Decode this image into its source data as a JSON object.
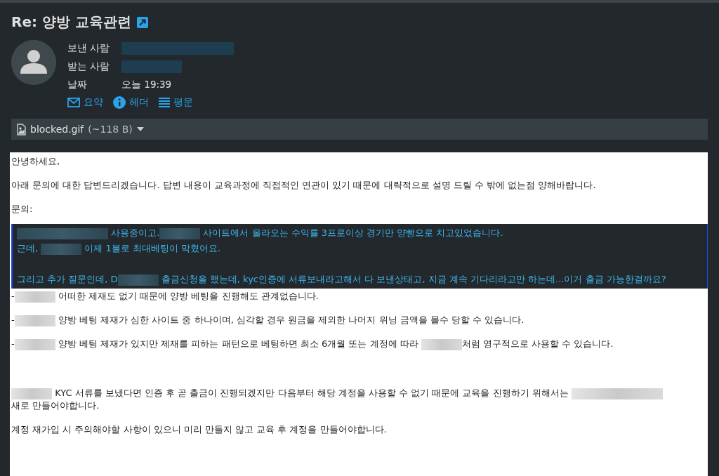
{
  "message": {
    "subject": "Re: 양방 교육관련",
    "headers": [
      {
        "label": "보낸 사람",
        "parts": [
          {
            "kind": "redacted-long"
          }
        ]
      },
      {
        "label": "받는 사람",
        "parts": [
          {
            "kind": "redacted"
          }
        ]
      },
      {
        "label": "날짜",
        "parts": [
          {
            "kind": "text",
            "text": "오늘 19:39"
          }
        ]
      }
    ],
    "view_links": [
      {
        "kind": "summary",
        "label": "요약"
      },
      {
        "kind": "headers",
        "label": "헤더"
      },
      {
        "kind": "plain",
        "label": "평문"
      }
    ]
  },
  "attachment": {
    "name": "blocked.gif",
    "size": "(~118 B)"
  },
  "body": [
    {
      "kind": "para",
      "parts": [
        {
          "kind": "text",
          "text": "안녕하세요,"
        }
      ]
    },
    {
      "kind": "para",
      "parts": [
        {
          "kind": "text",
          "text": "아래 문의에 대한 답변드리겠습니다. 답변 내용이 교육과정에 직접적인 연관이 있기 때문에 대략적으로 설명 드릴 수 밖에 없는점 양해바랍니다."
        }
      ]
    },
    {
      "kind": "para",
      "parts": [
        {
          "kind": "text",
          "text": "문의:"
        }
      ]
    },
    {
      "kind": "quote",
      "lines": [
        {
          "kind": "text",
          "parts": [
            {
              "kind": "redacted-long"
            },
            {
              "kind": "text",
              "text": " 사용중이고."
            },
            {
              "kind": "redacted"
            },
            {
              "kind": "text",
              "text": " 사이트에서 올라오는 수익률 3프로이상 경기만 양빵으로 치고있었습니다."
            }
          ]
        },
        {
          "kind": "text",
          "parts": [
            {
              "kind": "text",
              "text": "근데, "
            },
            {
              "kind": "redacted"
            },
            {
              "kind": "text",
              "text": " 이제 1불로 최대베팅이 막혔어요."
            }
          ]
        },
        {
          "kind": "blank"
        },
        {
          "kind": "text",
          "parts": [
            {
              "kind": "text",
              "text": "그리고 추가 질문인데, D"
            },
            {
              "kind": "redacted"
            },
            {
              "kind": "text",
              "text": " 출금신청을 했는데, kyc인증에 서류보내라고해서 다 보낸상태고, 지금 계속 기다리라고만 하는데...이거 출금 가능한걸까요?"
            }
          ]
        }
      ]
    },
    {
      "kind": "para",
      "parts": [
        {
          "kind": "text",
          "text": "-"
        },
        {
          "kind": "redacted"
        },
        {
          "kind": "text",
          "text": " 어떠한 제재도 없기 때문에 양방 베팅을 진행해도 관계없습니다."
        }
      ]
    },
    {
      "kind": "para",
      "parts": [
        {
          "kind": "text",
          "text": "-"
        },
        {
          "kind": "redacted"
        },
        {
          "kind": "text",
          "text": " 양방 베팅 제재가 심한 사이트 중 하나이며, 심각할 경우 원금을 제외한 나머지 위닝 금액을 몰수 당할 수 있습니다."
        }
      ]
    },
    {
      "kind": "para",
      "parts": [
        {
          "kind": "text",
          "text": "-"
        },
        {
          "kind": "redacted"
        },
        {
          "kind": "text",
          "text": " 양방 베팅 제재가 있지만 제재를 피하는 패턴으로 베팅하면 최소 6개월 또는 계정에 따라 "
        },
        {
          "kind": "redacted"
        },
        {
          "kind": "text",
          "text": "처럼 영구적으로 사용할 수 있습니다."
        }
      ]
    },
    {
      "kind": "blank"
    },
    {
      "kind": "blank"
    },
    {
      "kind": "para",
      "parts": [
        {
          "kind": "redacted"
        },
        {
          "kind": "text",
          "text": " KYC 서류를 보냈다면 인증 후 곧 출금이 진행되겠지만 다음부터 해당 계정을 사용할 수 없기 때문에 교육을 진행하기 위해서는 "
        },
        {
          "kind": "redacted-long"
        },
        {
          "kind": "break"
        },
        {
          "kind": "text",
          "text": "새로 만들어야합니다."
        }
      ]
    },
    {
      "kind": "para",
      "parts": [
        {
          "kind": "text",
          "text": "계정 재가입 시 주의해야할 사항이 있으니 미리 만들지 않고 교육 후 계정을 만들어야합니다."
        }
      ]
    }
  ]
}
